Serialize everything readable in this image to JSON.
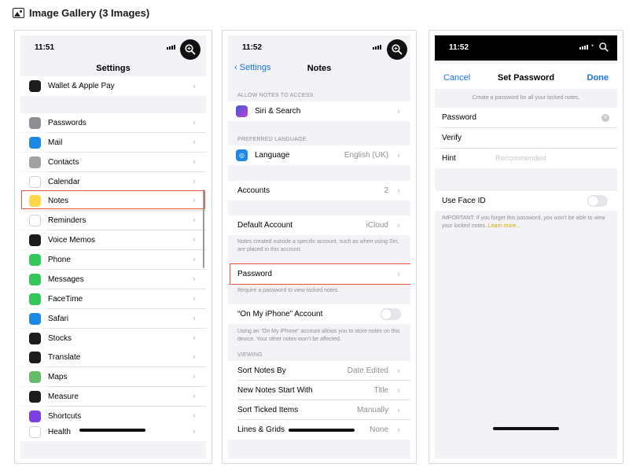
{
  "header": {
    "title": "Image Gallery (3 Images)",
    "icon": "image-gallery-icon"
  },
  "screen1": {
    "time": "11:51",
    "title": "Settings",
    "items": [
      {
        "label": "Wallet & Apple Pay",
        "icon": "wallet-icon",
        "color": "#1c1c1e"
      },
      {
        "label": "Passwords",
        "icon": "key-icon",
        "color": "#8e8e93"
      },
      {
        "label": "Mail",
        "icon": "mail-icon",
        "color": "#1e88e5"
      },
      {
        "label": "Contacts",
        "icon": "contacts-icon",
        "color": "#a0a0a5"
      },
      {
        "label": "Calendar",
        "icon": "calendar-icon",
        "color": "#ffffff"
      },
      {
        "label": "Notes",
        "icon": "notes-icon",
        "color": "#ffd54a"
      },
      {
        "label": "Reminders",
        "icon": "reminders-icon",
        "color": "#ffffff"
      },
      {
        "label": "Voice Memos",
        "icon": "voice-memos-icon",
        "color": "#1c1c1e"
      },
      {
        "label": "Phone",
        "icon": "phone-icon",
        "color": "#34c759"
      },
      {
        "label": "Messages",
        "icon": "messages-icon",
        "color": "#34c759"
      },
      {
        "label": "FaceTime",
        "icon": "facetime-icon",
        "color": "#34c759"
      },
      {
        "label": "Safari",
        "icon": "safari-icon",
        "color": "#1e88e5"
      },
      {
        "label": "Stocks",
        "icon": "stocks-icon",
        "color": "#1c1c1e"
      },
      {
        "label": "Translate",
        "icon": "translate-icon",
        "color": "#1c1c1e"
      },
      {
        "label": "Maps",
        "icon": "maps-icon",
        "color": "#66bb6a"
      },
      {
        "label": "Measure",
        "icon": "measure-icon",
        "color": "#1c1c1e"
      },
      {
        "label": "Shortcuts",
        "icon": "shortcuts-icon",
        "color": "#7b3fe4"
      },
      {
        "label": "Health",
        "icon": "health-icon",
        "color": "#ffffff"
      }
    ]
  },
  "screen2": {
    "time": "11:52",
    "back": "Settings",
    "title": "Notes",
    "allow_header": "ALLOW NOTES TO ACCESS",
    "siri": "Siri & Search",
    "language_header": "PREFERRED LANGUAGE",
    "language": {
      "label": "Language",
      "value": "English (UK)"
    },
    "accounts": {
      "label": "Accounts",
      "value": "2"
    },
    "default_account": {
      "label": "Default Account",
      "value": "iCloud"
    },
    "default_note": "Notes created outside a specific account, such as when using Siri, are placed in this account.",
    "password": "Password",
    "password_note": "Require a password to view locked notes.",
    "on_my_iphone": "“On My iPhone” Account",
    "on_my_iphone_note": "Using an “On My iPhone” account allows you to store notes on this device. Your other notes won’t be affected.",
    "viewing_header": "VIEWING",
    "viewing": [
      {
        "label": "Sort Notes By",
        "value": "Date Edited"
      },
      {
        "label": "New Notes Start With",
        "value": "Title"
      },
      {
        "label": "Sort Ticked Items",
        "value": "Manually"
      },
      {
        "label": "Lines & Grids",
        "value": "None"
      }
    ]
  },
  "screen3": {
    "time": "11:52",
    "cancel": "Cancel",
    "title": "Set Password",
    "done": "Done",
    "subtitle": "Create a password for all your locked notes.",
    "password_label": "Password",
    "verify_label": "Verify",
    "hint_label": "Hint",
    "hint_placeholder": "Recommended",
    "face_id": "Use Face ID",
    "important": "IMPORTANT: If you forget this password, you won’t be able to view your locked notes.",
    "learn_more": "Learn more..."
  },
  "colors": {
    "accent": "#1a73e8",
    "highlight": "#e8553d",
    "link": "#e8a100"
  }
}
